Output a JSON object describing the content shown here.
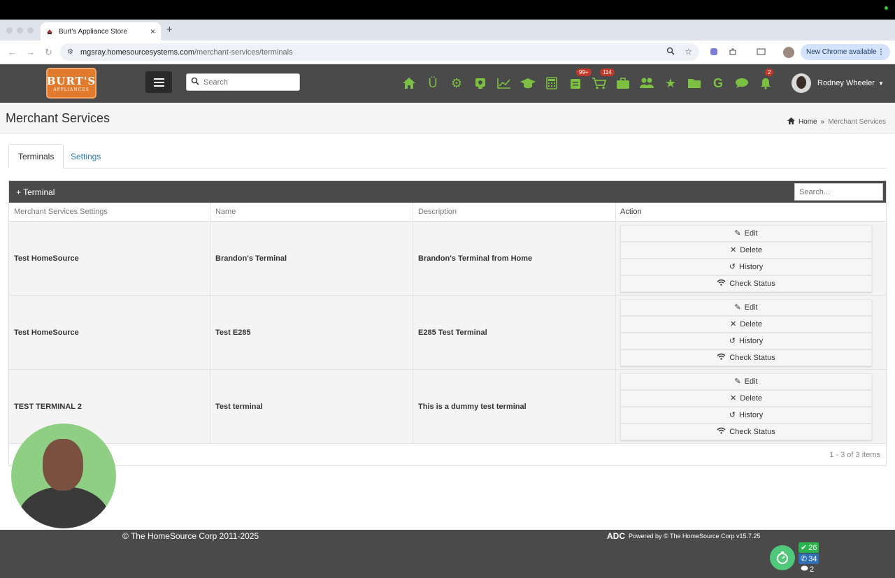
{
  "browser": {
    "tab_title": "Burt's Appliance Store",
    "close_glyph": "×",
    "new_tab_glyph": "+",
    "url_host": "mgsray.homesourcesystems.com",
    "url_path": "/merchant-services/terminals",
    "new_chrome": "New Chrome available"
  },
  "header": {
    "logo_main": "BURT'S",
    "logo_sub": "APPLIANCES",
    "search_placeholder": "Search",
    "badges": {
      "tasks": "99+",
      "cart": "114",
      "notifications": "2"
    },
    "g_label": "G",
    "user_name": "Rodney Wheeler"
  },
  "page": {
    "title": "Merchant Services",
    "breadcrumb_home": "Home",
    "breadcrumb_sep": "»",
    "breadcrumb_current": "Merchant Services"
  },
  "tabs": {
    "terminals": "Terminals",
    "settings": "Settings"
  },
  "grid": {
    "add_button": "+ Terminal",
    "search_placeholder": "Search...",
    "columns": [
      "Merchant Services Settings",
      "Name",
      "Description",
      "Action"
    ],
    "rows": [
      {
        "settings": "Test HomeSource",
        "name": "Brandon's Terminal",
        "description": "Brandon's Terminal from Home"
      },
      {
        "settings": "Test HomeSource",
        "name": "Test E285",
        "description": "E285 Test Terminal"
      },
      {
        "settings": "TEST TERMINAL 2",
        "name": "Test terminal",
        "description": "This is a dummy test terminal"
      }
    ],
    "actions": {
      "edit": "Edit",
      "delete": "Delete",
      "history": "History",
      "check_status": "Check Status"
    },
    "pager": "1 - 3 of 3 items"
  },
  "footer": {
    "copyright": "© The HomeSource Corp 2011-2025",
    "adc": "ADC",
    "powered": "Powered by © The HomeSource Corp   v15.7.25",
    "count_done": "26",
    "count_calls": "34",
    "count_chats": "2"
  },
  "colors": {
    "brand_green": "#7cc043",
    "header_bg": "#4a4a4a",
    "logo_orange": "#e07b2e",
    "link_blue": "#2a7ab0",
    "badge_red": "#c0392b"
  }
}
